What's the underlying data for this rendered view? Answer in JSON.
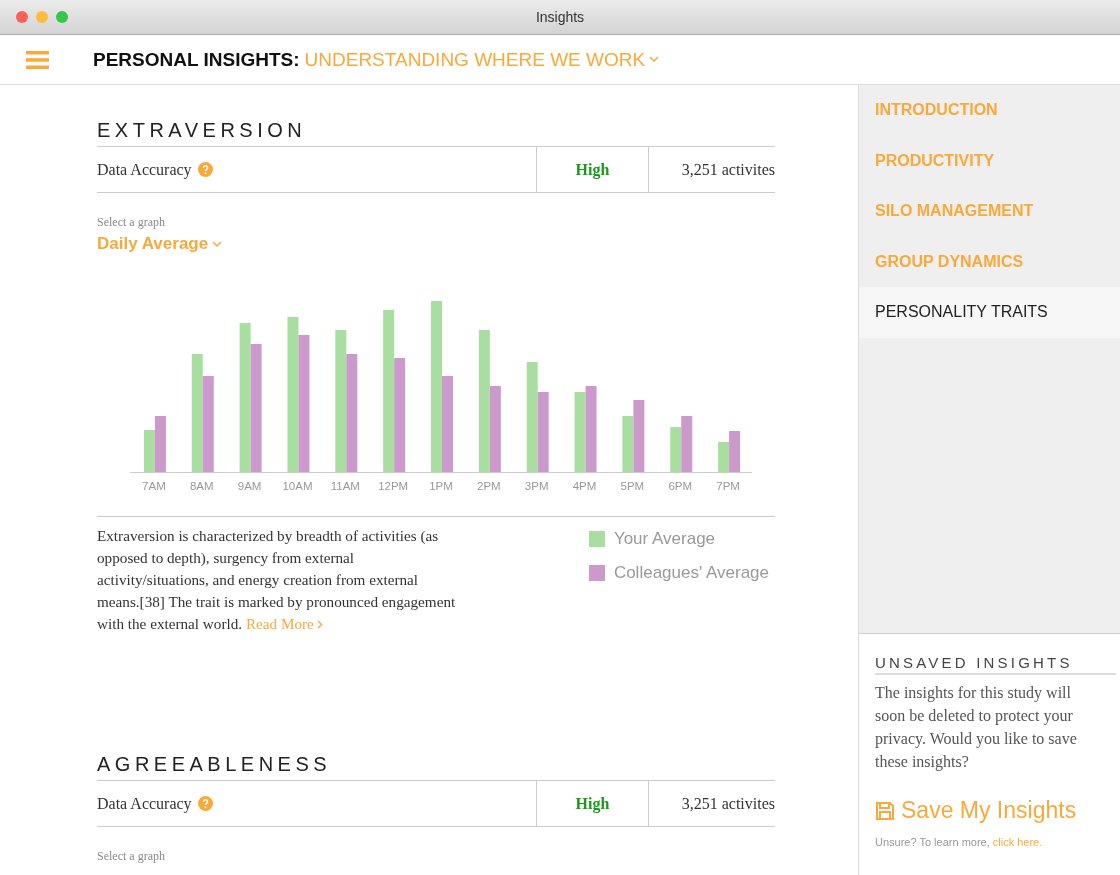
{
  "window": {
    "title": "Insights"
  },
  "header": {
    "title": "PERSONAL INSIGHTS:",
    "study": "UNDERSTANDING WHERE WE WORK"
  },
  "sections": [
    {
      "title": "EXTRAVERSION",
      "accuracy_label": "Data Accuracy",
      "accuracy": "High",
      "activities": "3,251 activites",
      "select_label": "Select a graph",
      "graph": "Daily Average",
      "x_labels": [
        "7AM",
        "8AM",
        "9AM",
        "10AM",
        "11AM",
        "12PM",
        "1PM",
        "2PM",
        "3PM",
        "4PM",
        "5PM",
        "6PM",
        "7PM"
      ],
      "legend": [
        {
          "label": "Your Average",
          "color": "#a8dfa0"
        },
        {
          "label": "Colleagues' Average",
          "color": "#cc99cc"
        }
      ],
      "description": "Extraversion is characterized by breadth of activities (as opposed to depth), surgency from external activity/situations, and energy creation from external means.[38] The trait is marked by pronounced engagement with the external world.",
      "read_more": "Read More"
    },
    {
      "title": "AGREEABLENESS",
      "accuracy_label": "Data Accuracy",
      "accuracy": "High",
      "activities": "3,251 activites",
      "select_label": "Select a graph"
    }
  ],
  "sidebar": {
    "items": [
      {
        "label": "INTRODUCTION",
        "selected": false
      },
      {
        "label": "PRODUCTIVITY",
        "selected": false
      },
      {
        "label": "SILO MANAGEMENT",
        "selected": false
      },
      {
        "label": "GROUP DYNAMICS",
        "selected": false
      },
      {
        "label": "PERSONALITY TRAITS",
        "selected": true
      }
    ],
    "unsaved": {
      "title": "UNSAVED INSIGHTS",
      "text": "The insights for this study will soon be deleted to protect your privacy. Would you like to save these insights?",
      "save": "Save My Insights",
      "note": "Unsure? To learn more,",
      "link": "click here."
    }
  }
}
